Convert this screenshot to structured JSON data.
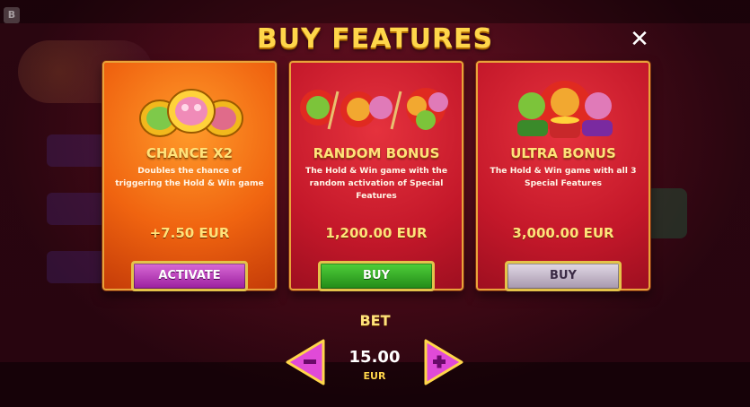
{
  "title": "BUY FEATURES",
  "close_icon": "close-icon",
  "cards": [
    {
      "title": "CHANCE X2",
      "description": "Doubles the chance of triggering the Hold & Win game",
      "price": "+7.50 EUR",
      "button": "ACTIVATE",
      "button_color": "#a82aa9",
      "icon": "three-coins-icon"
    },
    {
      "title": "RANDOM BONUS",
      "description": "The Hold & Win game with the random activation of Special Features",
      "price": "1,200.00 EUR",
      "button": "BUY",
      "button_color": "#2f9e22",
      "icon": "monkeys-random-icon"
    },
    {
      "title": "ULTRA BONUS",
      "description": "The Hold & Win game with all 3 Special Features",
      "price": "3,000.00 EUR",
      "button": "BUY",
      "button_color": "#b3a5b8",
      "icon": "three-monkeys-pots-icon"
    }
  ],
  "bet": {
    "label": "BET",
    "value": "15.00",
    "currency": "EUR"
  },
  "colors": {
    "gold_text": "#ffd64a",
    "card_orange": "#f06410",
    "card_red": "#c4182a",
    "arrow_pink": "#e04ad8"
  }
}
